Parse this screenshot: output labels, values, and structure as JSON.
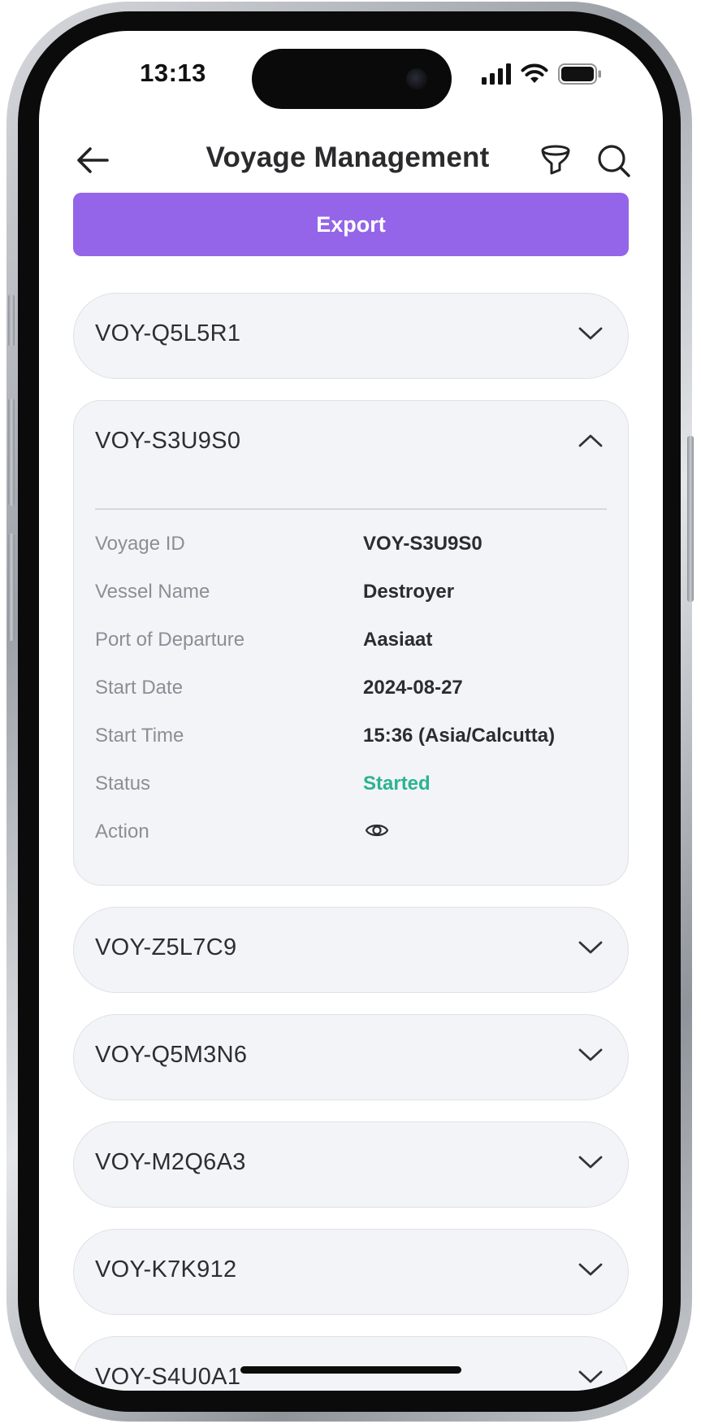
{
  "status_bar": {
    "time": "13:13"
  },
  "header": {
    "title": "Voyage Management"
  },
  "toolbar": {
    "export_label": "Export"
  },
  "colors": {
    "accent": "#9465e8",
    "status_started": "#2ab393"
  },
  "voyages": [
    {
      "id": "VOY-Q5L5R1",
      "expanded": false
    },
    {
      "id": "VOY-S3U9S0",
      "expanded": true,
      "details": {
        "voyage_id": {
          "label": "Voyage ID",
          "value": "VOY-S3U9S0"
        },
        "vessel_name": {
          "label": "Vessel Name",
          "value": "Destroyer"
        },
        "port_of_departure": {
          "label": "Port of Departure",
          "value": "Aasiaat"
        },
        "start_date": {
          "label": "Start Date",
          "value": "2024-08-27"
        },
        "start_time": {
          "label": "Start Time",
          "value": "15:36 (Asia/Calcutta)"
        },
        "status": {
          "label": "Status",
          "value": "Started"
        },
        "action": {
          "label": "Action",
          "icon": "eye-icon"
        }
      }
    },
    {
      "id": "VOY-Z5L7C9",
      "expanded": false
    },
    {
      "id": "VOY-Q5M3N6",
      "expanded": false
    },
    {
      "id": "VOY-M2Q6A3",
      "expanded": false
    },
    {
      "id": "VOY-K7K912",
      "expanded": false
    },
    {
      "id": "VOY-S4U0A1",
      "expanded": false
    }
  ]
}
